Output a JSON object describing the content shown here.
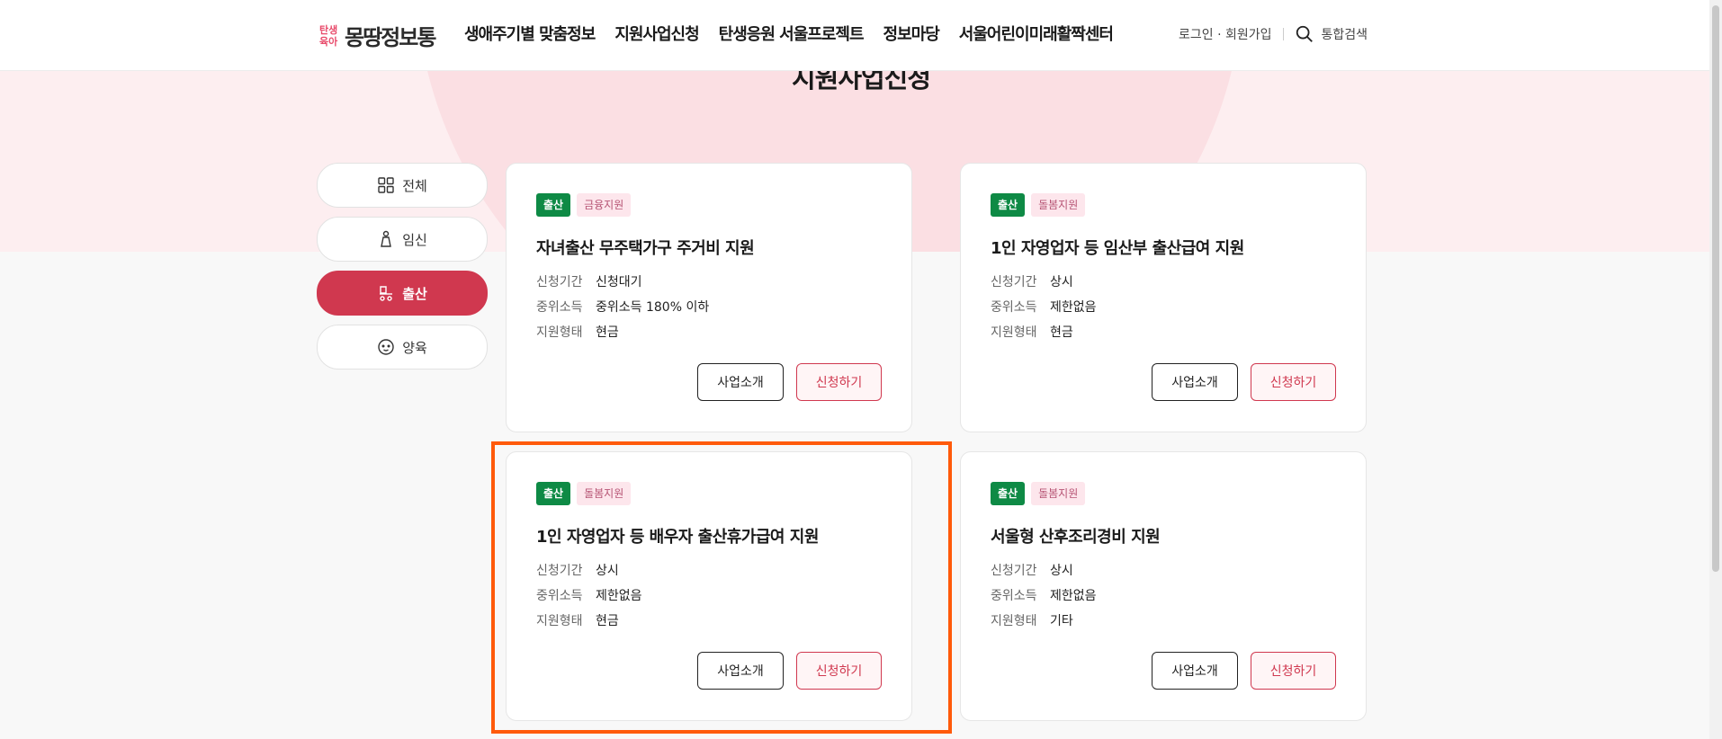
{
  "header": {
    "logo_small_line1": "탄생",
    "logo_small_line2": "육아",
    "logo_main": "몽땅정보통",
    "nav": [
      "생애주기별 맞춤정보",
      "지원사업신청",
      "탄생응원 서울프로젝트",
      "정보마당",
      "서울어린이미래활짝센터"
    ],
    "login": "로그인 · 회원가입",
    "search": "통합검색"
  },
  "page_title": "지원사업신청",
  "categories": [
    {
      "label": "전체",
      "icon": "grid-icon",
      "active": false
    },
    {
      "label": "임신",
      "icon": "pregnancy-icon",
      "active": false
    },
    {
      "label": "출산",
      "icon": "stroller-icon",
      "active": true
    },
    {
      "label": "양육",
      "icon": "baby-face-icon",
      "active": false
    }
  ],
  "info_keys": {
    "period": "신청기간",
    "income": "중위소득",
    "type": "지원형태"
  },
  "buttons": {
    "intro": "사업소개",
    "apply": "신청하기"
  },
  "cards": [
    {
      "tag1": "출산",
      "tag2": "금융지원",
      "title": "자녀출산 무주택가구 주거비 지원",
      "period": "신청대기",
      "income": "중위소득 180% 이하",
      "type": "현금"
    },
    {
      "tag1": "출산",
      "tag2": "돌봄지원",
      "title": "1인 자영업자 등 임산부 출산급여 지원",
      "period": "상시",
      "income": "제한없음",
      "type": "현금"
    },
    {
      "tag1": "출산",
      "tag2": "돌봄지원",
      "title": "1인 자영업자 등 배우자 출산휴가급여 지원",
      "period": "상시",
      "income": "제한없음",
      "type": "현금"
    },
    {
      "tag1": "출산",
      "tag2": "돌봄지원",
      "title": "서울형 산후조리경비 지원",
      "period": "상시",
      "income": "제한없음",
      "type": "기타"
    }
  ],
  "colors": {
    "accent": "#d0384f",
    "green_tag": "#0e8a45",
    "highlight": "#ff5a0a"
  }
}
